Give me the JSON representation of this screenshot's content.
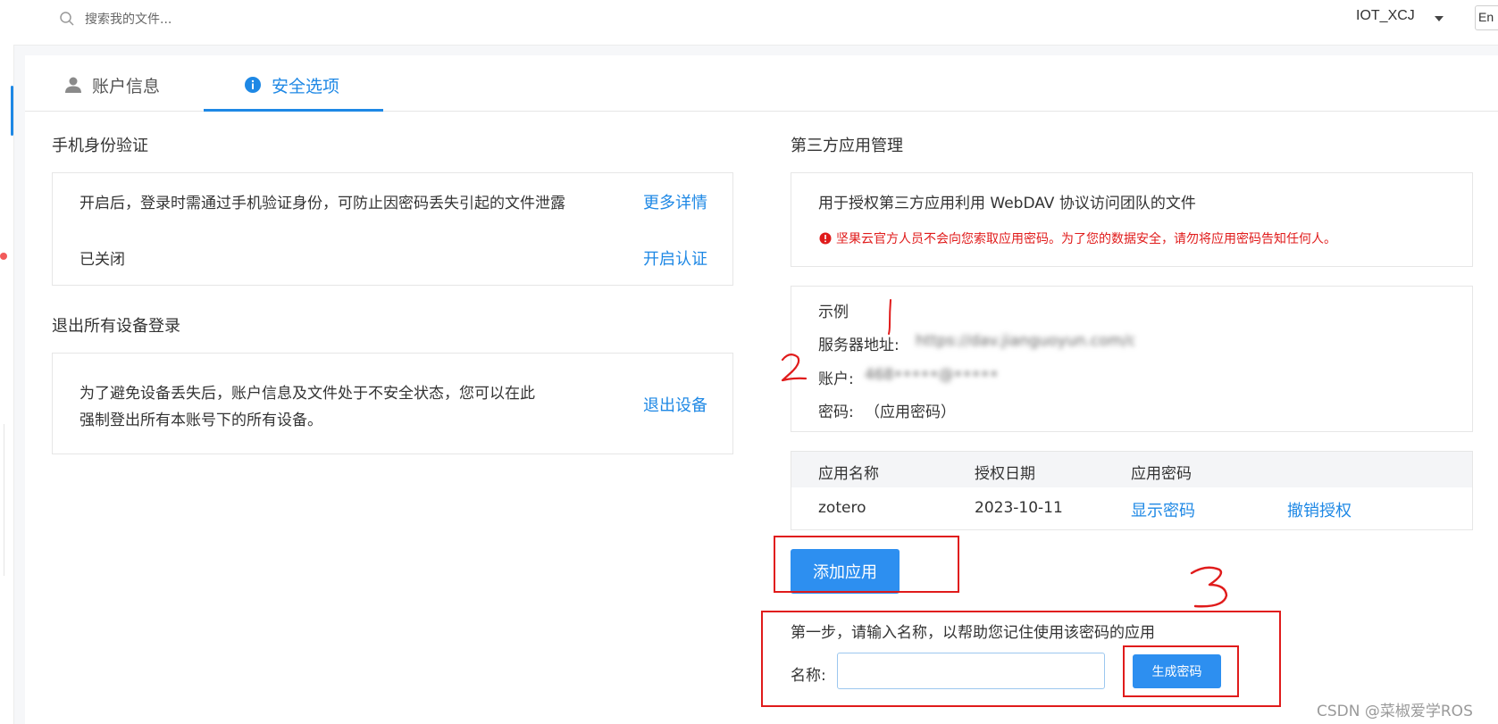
{
  "topbar": {
    "search_placeholder": "搜索我的文件...",
    "username": "IOT_XCJ",
    "lang": "En"
  },
  "tabs": [
    {
      "label": "账户信息",
      "icon": "user-icon",
      "active": false
    },
    {
      "label": "安全选项",
      "icon": "info-icon",
      "active": true
    }
  ],
  "phone_auth": {
    "title": "手机身份验证",
    "desc": "开启后，登录时需通过手机验证身份，可防止因密码丢失引起的文件泄露",
    "more_link": "更多详情",
    "status": "已关闭",
    "enable_link": "开启认证"
  },
  "logout_all": {
    "title": "退出所有设备登录",
    "desc_line1": "为了避免设备丢失后，账户信息及文件处于不安全状态，您可以在此",
    "desc_line2": "强制登出所有本账号下的所有设备。",
    "logout_link": "退出设备"
  },
  "third_party": {
    "title": "第三方应用管理",
    "desc": "用于授权第三方应用利用 WebDAV 协议访问团队的文件",
    "warning": "坚果云官方人员不会向您索取应用密码。为了您的数据安全，请勿将应用密码告知任何人。",
    "example_title": "示例",
    "server_label": "服务器地址:",
    "server_value": "https://dav.jianguoyun.com/dav/",
    "account_label": "账户:",
    "account_value": "468•••••@•••••",
    "password_label": "密码:",
    "password_value": "（应用密码）",
    "table_headers": [
      "应用名称",
      "授权日期",
      "应用密码"
    ],
    "rows": [
      {
        "name": "zotero",
        "date": "2023-10-11",
        "show": "显示密码",
        "revoke": "撤销授权"
      }
    ],
    "add_button": "添加应用",
    "step1": "第一步，请输入名称，以帮助您记住使用该密码的应用",
    "name_label": "名称:",
    "name_value": "",
    "generate_button": "生成密码"
  },
  "annotations": [
    "1",
    "2",
    "3"
  ],
  "watermark": "CSDN @菜椒爱学ROS",
  "colors": {
    "accent": "#1e88e5",
    "warning": "#e01b1b"
  }
}
